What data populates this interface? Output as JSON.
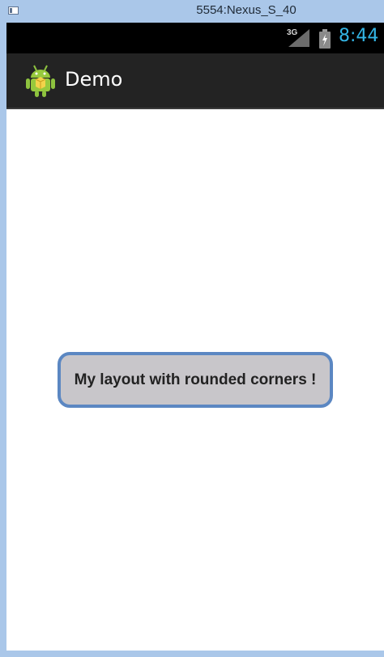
{
  "window": {
    "title": "5554:Nexus_S_40"
  },
  "status_bar": {
    "network_label": "3G",
    "time": "8:44",
    "icons": [
      "signal-icon",
      "battery-icon"
    ]
  },
  "action_bar": {
    "title": "Demo",
    "icon": "android-icon"
  },
  "main": {
    "box_text": "My layout with rounded corners !"
  },
  "colors": {
    "clock": "#33b5e5",
    "action_bar": "#232323",
    "box_fill": "#c8c6ca",
    "box_border": "#5b87c2"
  }
}
